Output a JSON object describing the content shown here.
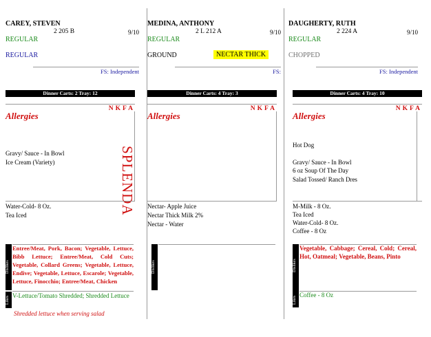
{
  "cards": [
    {
      "name": "CAREY, STEVEN",
      "room": "2 205 B",
      "date": "9/10",
      "diet1": "REGULAR",
      "diet2": "REGULAR",
      "fs": "FS: Independent",
      "cart": "Dinner   Carts: 2   Tray: 12",
      "nkfa": "NKFA",
      "allergies": "Allergies",
      "foods": [
        "Gravy/ Sauce - In Bowl",
        "Ice Cream  (Variety)"
      ],
      "splenda": "SPLENDA",
      "beverages": [
        "Water-Cold- 8 Oz.",
        "Tea Iced"
      ],
      "dislikes_label": "Dislikes",
      "dislikes": "Entree/Meat, Pork, Bacon; Vegetable, Lettuce, Bibb Lettuce; Entree/Meat, Cold Cuts; Vegetable, Collard Greens; Vegetable, Lettuce, Endive; Vegetable, Lettuce, Escarole; Vegetable, Lettuce, Finocchio; Entree/Meat, Chicken",
      "likes_label": "Likes",
      "likes": "V-Lettuce/Tomato Shredded; Shredded Lettuce",
      "note": "Shredded lettuce when serving salad"
    },
    {
      "name": "MEDINA, ANTHONY",
      "room": "2 L 212 A",
      "date": "9/10",
      "diet1": "REGULAR",
      "diet2": "GROUND",
      "highlight": "NECTAR THICK",
      "fs": "FS:",
      "cart": "Dinner   Carts: 4   Tray: 3",
      "nkfa": "NKFA",
      "allergies": "Allergies",
      "beverages": [
        "Nectar- Apple Juice",
        "Nectar Thick Milk  2%",
        "Nectar - Water"
      ],
      "dislikes_label": "Dislikes"
    },
    {
      "name": "DAUGHERTY, RUTH",
      "room": "2 224 A",
      "date": "9/10",
      "diet1": "REGULAR",
      "diet2": "CHOPPED",
      "fs": "FS: Independent",
      "cart": "Dinner   Carts: 4   Tray: 10",
      "nkfa": "NKFA",
      "allergies": "Allergies",
      "foods_top": "Hot Dog",
      "foods": [
        "Gravy/ Sauce - In Bowl",
        "6 oz Soup Of The Day",
        "Salad Tossed/ Ranch Dres"
      ],
      "beverages": [
        "M-Milk - 8 Oz.",
        "Tea Iced",
        "Water-Cold- 8 Oz.",
        "Coffee - 8 Oz"
      ],
      "dislikes_label": "Dislikes",
      "dislikes": "Vegetable, Cabbage; Cereal, Cold; Cereal, Hot, Oatmeal; Vegetable, Beans, Pinto",
      "likes_label": "Likes",
      "likes": "Coffee - 8 Oz"
    }
  ]
}
